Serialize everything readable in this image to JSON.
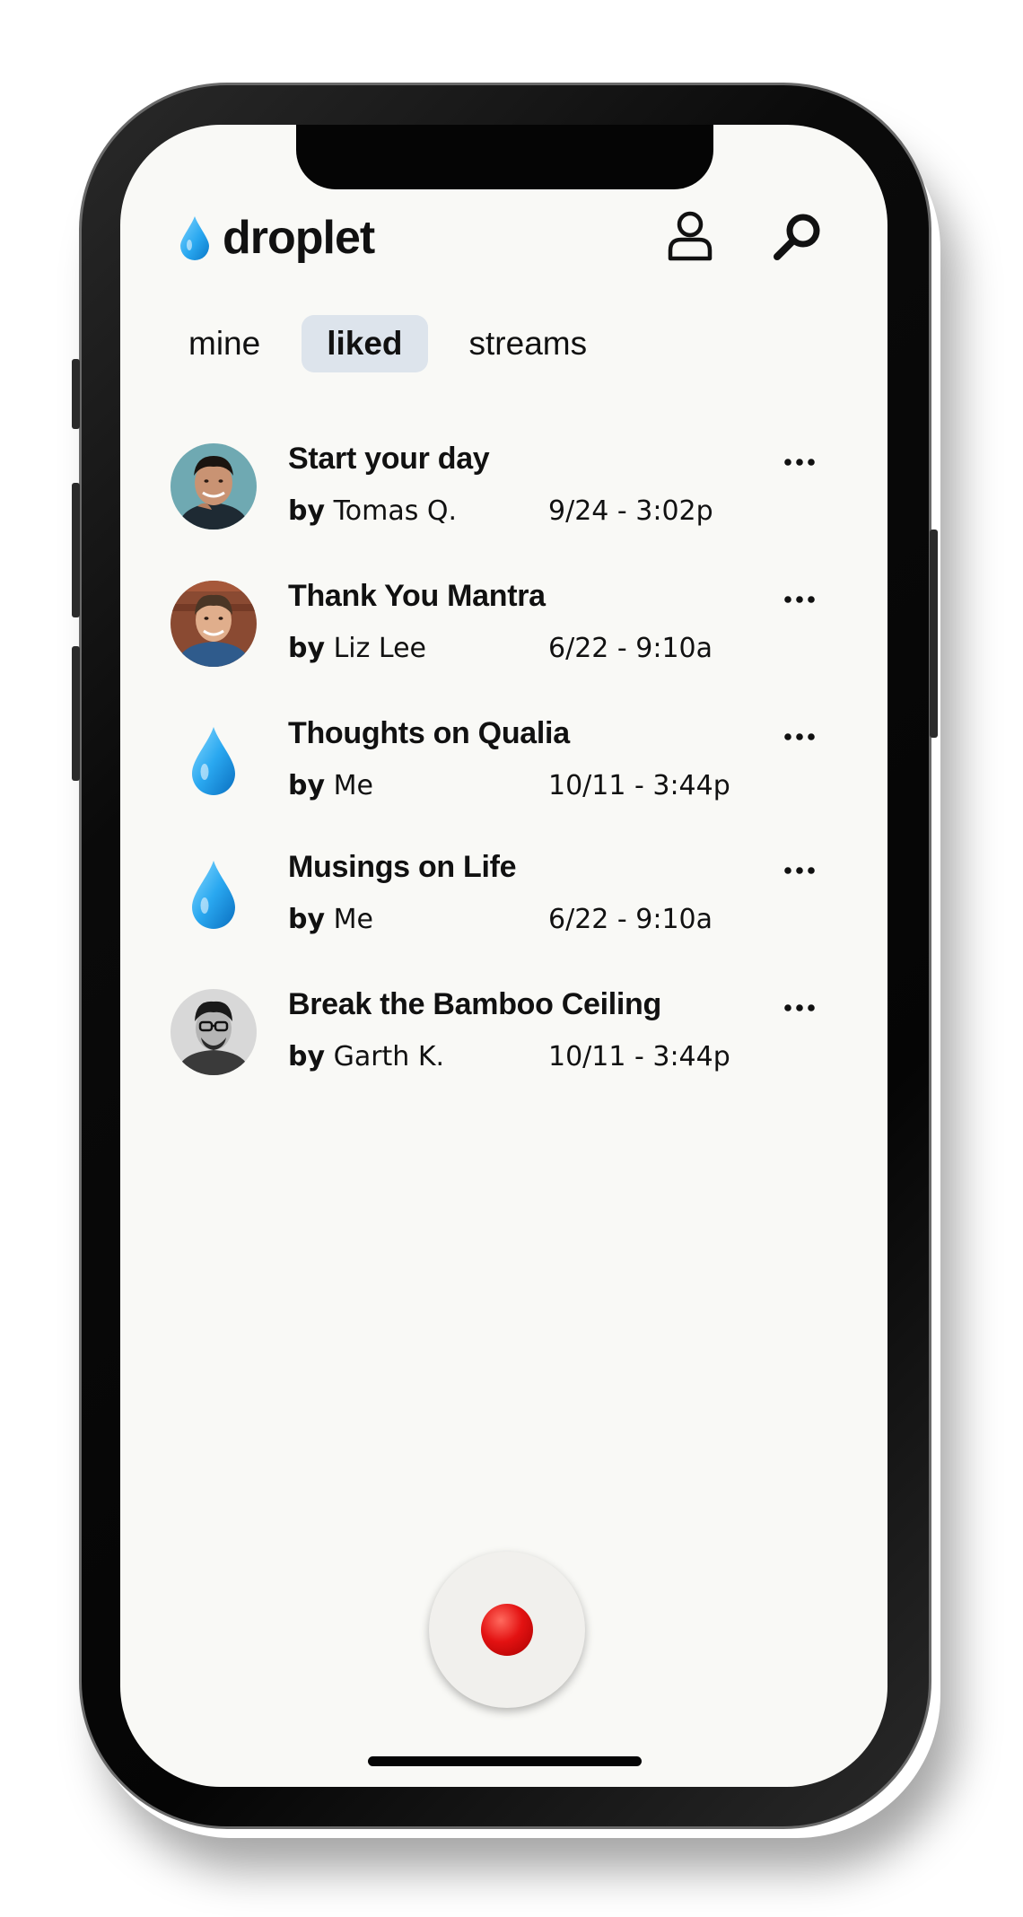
{
  "app": {
    "name": "droplet"
  },
  "tabs": [
    {
      "label": "mine",
      "active": false
    },
    {
      "label": "liked",
      "active": true
    },
    {
      "label": "streams",
      "active": false
    }
  ],
  "items": [
    {
      "title": "Start your day",
      "by_label": "by",
      "author": "Tomas Q.",
      "date": "9/24 - 3:02p",
      "avatar": "photo-tomas"
    },
    {
      "title": "Thank You Mantra",
      "by_label": "by",
      "author": "Liz Lee",
      "date": "6/22 - 9:10a",
      "avatar": "photo-liz"
    },
    {
      "title": "Thoughts on Qualia",
      "by_label": "by",
      "author": "Me",
      "date": "10/11 - 3:44p",
      "avatar": "droplet-icon"
    },
    {
      "title": "Musings on Life",
      "by_label": "by",
      "author": "Me",
      "date": "6/22 - 9:10a",
      "avatar": "droplet-icon"
    },
    {
      "title": "Break the Bamboo Ceiling",
      "by_label": "by",
      "author": "Garth K.",
      "date": "10/11 - 3:44p",
      "avatar": "photo-garth"
    }
  ],
  "colors": {
    "accent_blue": "#2aa8f0",
    "active_tab_bg": "#dde4ec",
    "record_red": "#e31212",
    "screen_bg": "#f9f9f6"
  },
  "icons": {
    "profile": "user-icon",
    "search": "search-icon",
    "more": "ellipsis-icon",
    "record": "record-icon"
  }
}
